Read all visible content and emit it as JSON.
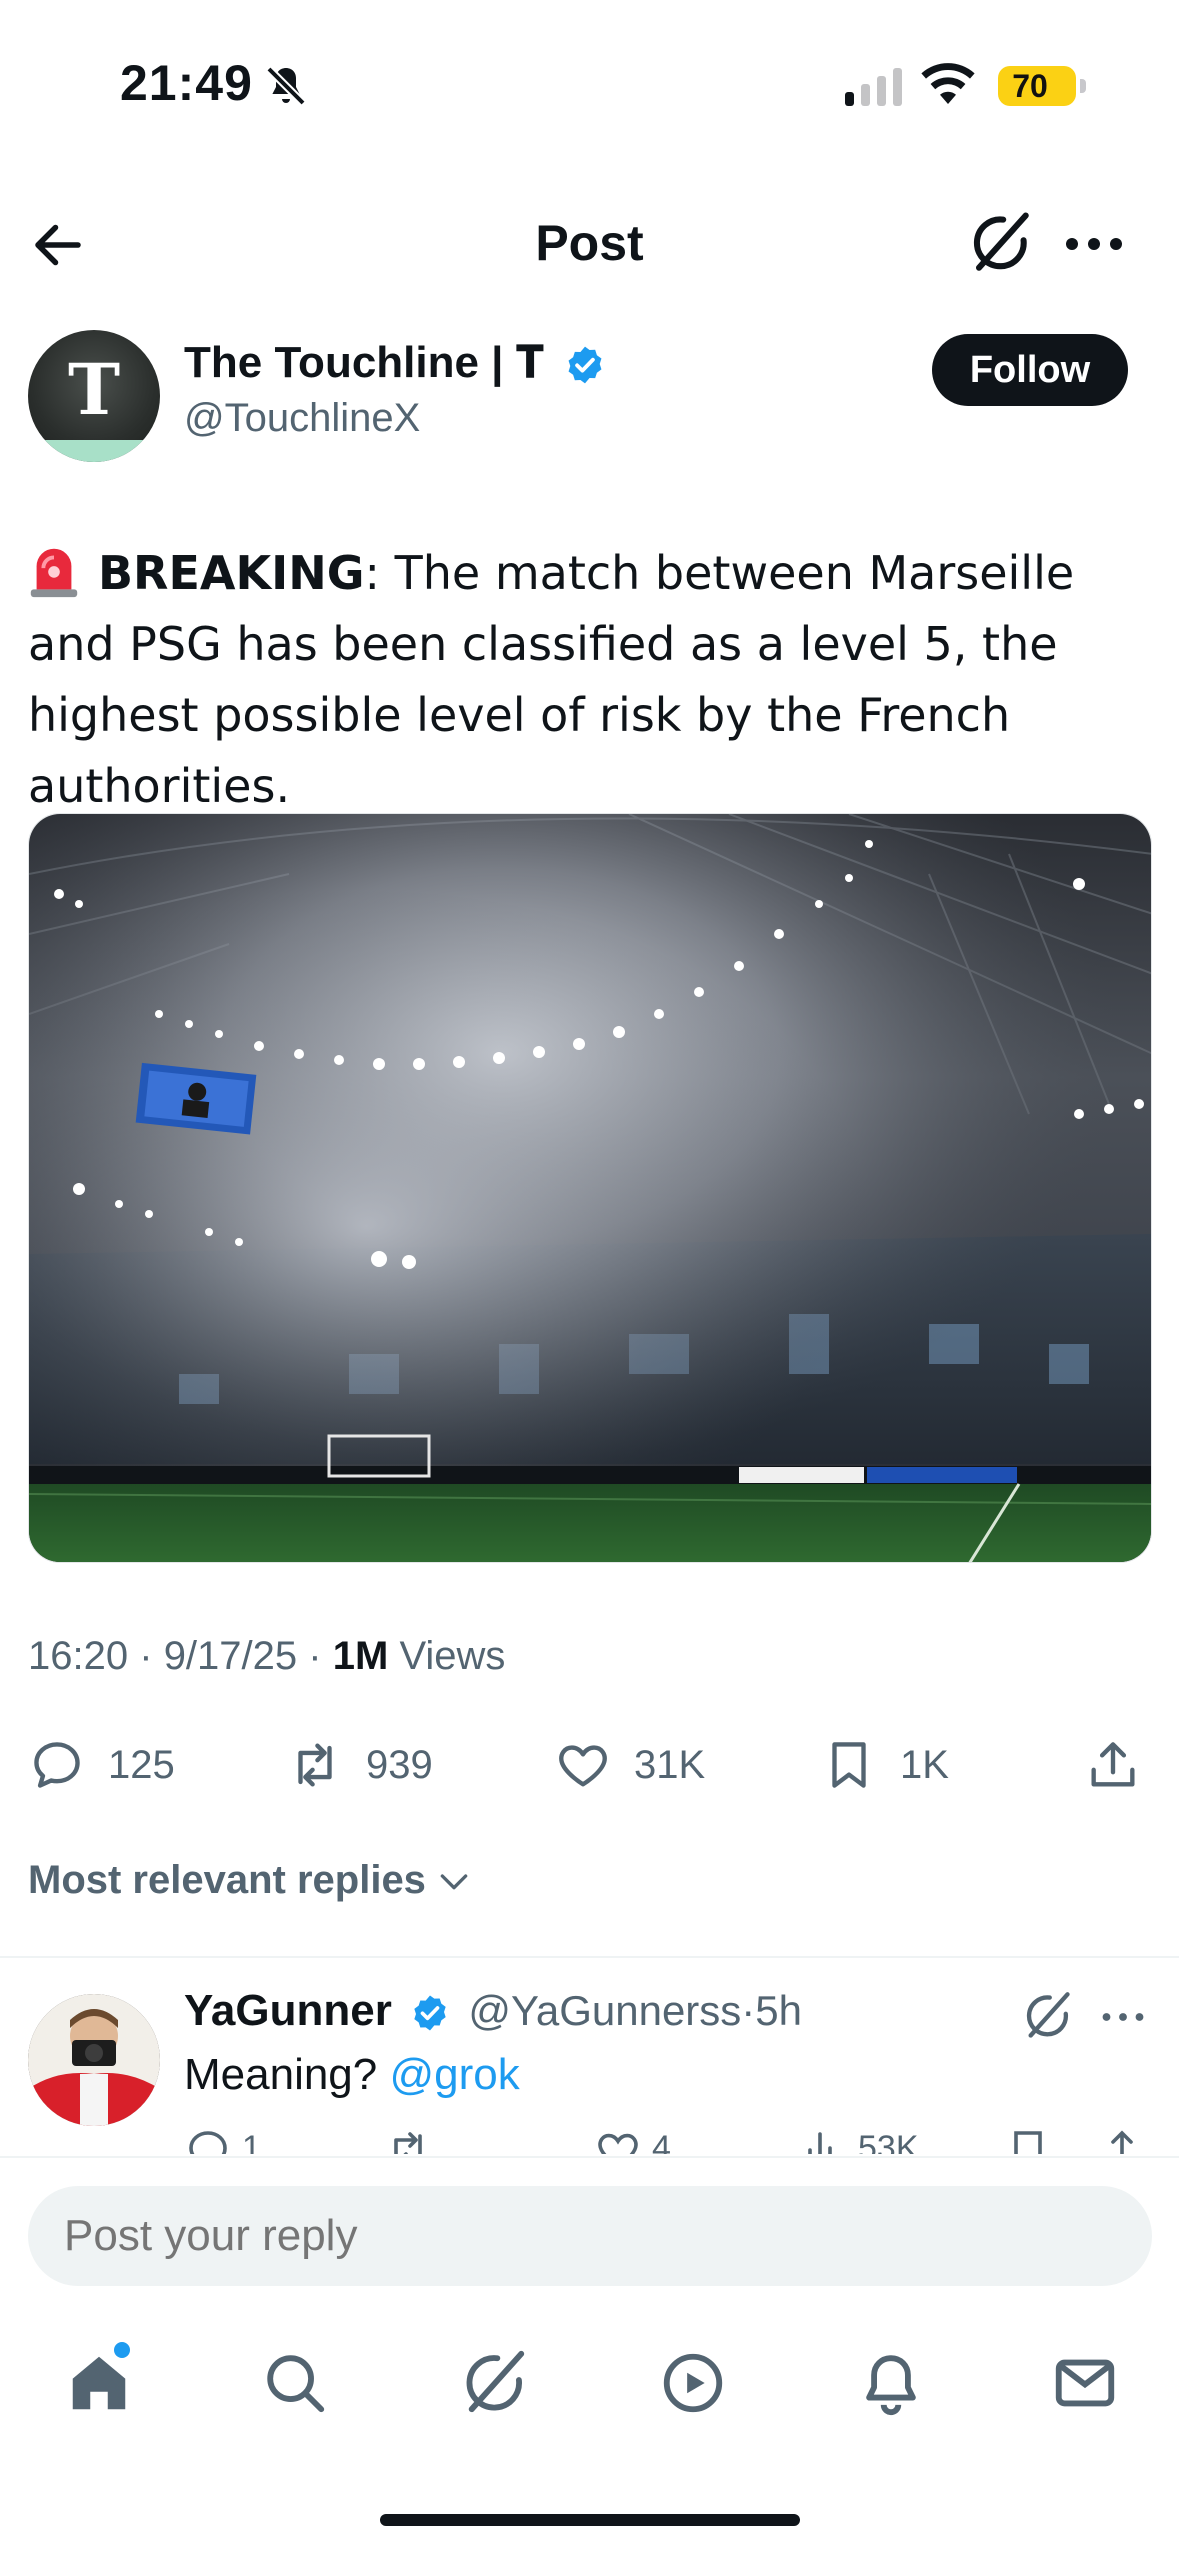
{
  "status_bar": {
    "time": "21:49",
    "battery": "70",
    "battery_color": "#fbd114"
  },
  "nav": {
    "title": "Post"
  },
  "author": {
    "name": "The Touchline | 𝐓",
    "handle": "@TouchlineX",
    "avatar_letter": "T",
    "follow_label": "Follow"
  },
  "tweet": {
    "emoji": "siren-icon",
    "bold": "BREAKING",
    "text": ": The match between Marseille and PSG has been classified as a level 5, the highest possible level of risk by the French authorities."
  },
  "meta": {
    "time": "16:20",
    "date": "9/17/25",
    "views_count": "1M",
    "views_label": "Views",
    "separator": "·"
  },
  "actions": {
    "replies": "125",
    "reposts": "939",
    "likes": "31K",
    "bookmarks": "1K"
  },
  "replies_filter": "Most relevant replies",
  "reply": {
    "name": "YaGunner",
    "handle": "@YaGunnerss",
    "time": "5h",
    "text_prefix": "Meaning? ",
    "mention": "@grok",
    "replies": "1",
    "likes": "4",
    "views": "53K"
  },
  "composer": {
    "placeholder": "Post your reply"
  },
  "tabbar": [
    "home-icon",
    "search-icon",
    "grok-icon",
    "video-icon",
    "notifications-icon",
    "messages-icon"
  ],
  "colors": {
    "accent": "#1d9bf0",
    "text": "#0f1419",
    "secondary": "#536471"
  }
}
